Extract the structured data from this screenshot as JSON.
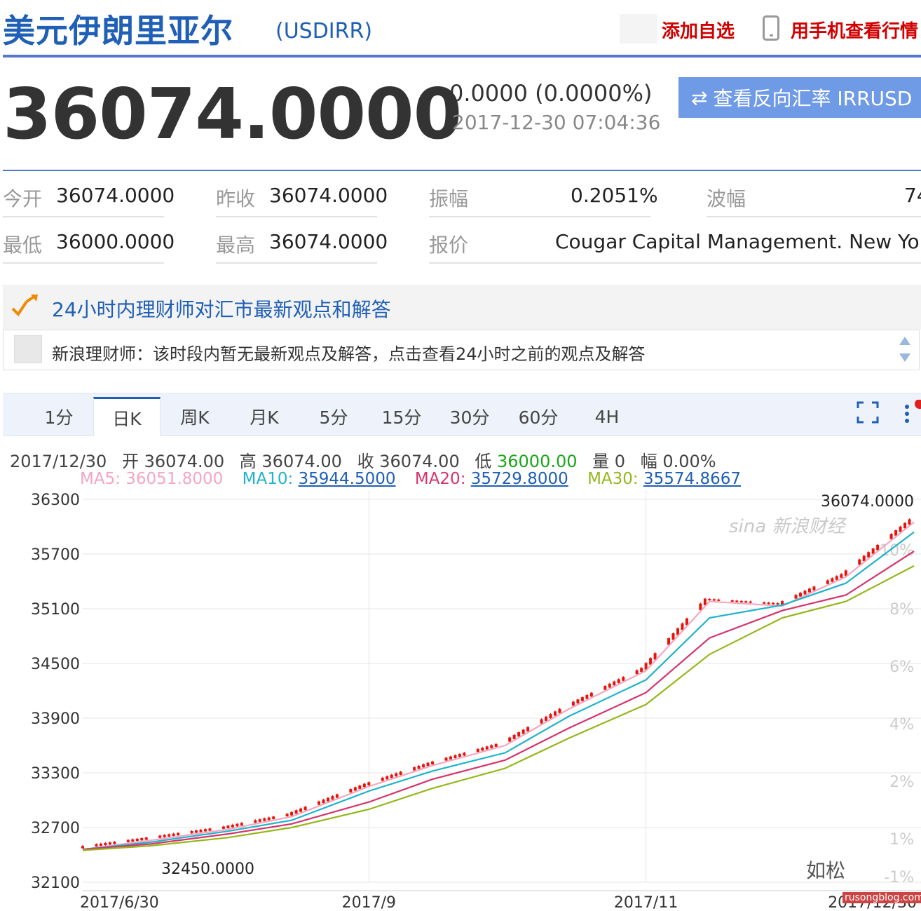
{
  "header": {
    "title": "美元伊朗里亚尔",
    "symbol": "(USDIRR)",
    "add_favorite": "添加自选",
    "mobile_view": "用手机查看行情"
  },
  "quote": {
    "price": "36074.0000",
    "change": "0.0000 (0.0000%)",
    "timestamp": "2017-12-30 07:04:36",
    "reverse_button": "查看反向汇率 IRRUSD",
    "reverse_icon": "swap-arrows-icon"
  },
  "stats": {
    "open_label": "今开",
    "open_value": "36074.0000",
    "prev_close_label": "昨收",
    "prev_close_value": "36074.0000",
    "amplitude_label": "振幅",
    "amplitude_value": "0.2051%",
    "wave_label": "波幅",
    "wave_value": "74",
    "low_label": "最低",
    "low_value": "36000.0000",
    "high_label": "最高",
    "high_value": "36074.0000",
    "quote_label": "报价",
    "quote_value": "Cougar Capital Management. New York"
  },
  "adviser": {
    "title": "24小时内理财师对汇市最新观点和解答",
    "message": "新浪理财师：该时段内暂无最新观点及解答，点击查看24小时之前的观点及解答"
  },
  "tabs": [
    {
      "label": "1分"
    },
    {
      "label": "日K"
    },
    {
      "label": "周K"
    },
    {
      "label": "月K"
    },
    {
      "label": "5分"
    },
    {
      "label": "15分"
    },
    {
      "label": "30分"
    },
    {
      "label": "60分"
    },
    {
      "label": "4H"
    }
  ],
  "active_tab": "日K",
  "kline_info": {
    "date": "2017/12/30",
    "open_label": "开",
    "open": "36074.00",
    "high_label": "高",
    "high": "36074.00",
    "close_label": "收",
    "close": "36074.00",
    "low_label": "低",
    "low": "36000.00",
    "volume_label": "量",
    "volume": "0",
    "range_label": "幅",
    "range": "0.00%",
    "ma5_label": "MA5:",
    "ma5": "36051.8000",
    "ma10_label": "MA10:",
    "ma10": "35944.5000",
    "ma20_label": "MA20:",
    "ma20": "35729.8000",
    "ma30_label": "MA30:",
    "ma30": "35574.8667"
  },
  "colors": {
    "up": "#e8140c",
    "down": "#1aa51a",
    "ma5": "#f4a6c0",
    "ma10": "#1fb3cc",
    "ma20": "#d6336c",
    "ma30": "#95b71a",
    "accent": "#1f5fb5"
  },
  "watermarks": {
    "sina": "sina 新浪财经",
    "rusong": "如松",
    "url": "rusongblog.com"
  },
  "chart_data": {
    "type": "candlestick",
    "y_ticks": [
      36300,
      35700,
      35100,
      34500,
      33900,
      33300,
      32700,
      32100
    ],
    "right_ticks": [
      "10%",
      "8%",
      "6%",
      "4%",
      "2%",
      "1%",
      "-1%"
    ],
    "x_ticks": [
      "2017/6/30",
      "2017/9",
      "2017/11",
      "2017/12/30"
    ],
    "ylim": [
      32100,
      36400
    ],
    "annotations": {
      "max": "36074.0000",
      "min": "32450.0000"
    },
    "grid": true,
    "series": [
      {
        "name": "MA5",
        "x": [
          "2017/6/30",
          "2017/7/15",
          "2017/8/1",
          "2017/8/15",
          "2017/9/1",
          "2017/9/15",
          "2017/10/1",
          "2017/10/15",
          "2017/11/1",
          "2017/11/15",
          "2017/12/1",
          "2017/12/15",
          "2017/12/30"
        ],
        "values": [
          32460,
          32560,
          32680,
          32820,
          33150,
          33380,
          33600,
          34000,
          34420,
          35180,
          35130,
          35450,
          36050
        ]
      },
      {
        "name": "MA10",
        "x": [
          "2017/6/30",
          "2017/7/15",
          "2017/8/1",
          "2017/8/15",
          "2017/9/1",
          "2017/9/15",
          "2017/10/1",
          "2017/10/15",
          "2017/11/1",
          "2017/11/15",
          "2017/12/1",
          "2017/12/15",
          "2017/12/30"
        ],
        "values": [
          32460,
          32540,
          32660,
          32780,
          33100,
          33320,
          33520,
          33920,
          34320,
          35000,
          35140,
          35380,
          35940
        ]
      },
      {
        "name": "MA20",
        "x": [
          "2017/6/30",
          "2017/7/15",
          "2017/8/1",
          "2017/8/15",
          "2017/9/1",
          "2017/9/15",
          "2017/10/1",
          "2017/10/15",
          "2017/11/1",
          "2017/11/15",
          "2017/12/1",
          "2017/12/15",
          "2017/12/30"
        ],
        "values": [
          32460,
          32520,
          32630,
          32740,
          32980,
          33230,
          33440,
          33790,
          34180,
          34780,
          35080,
          35250,
          35730
        ]
      },
      {
        "name": "MA30",
        "x": [
          "2017/6/30",
          "2017/7/15",
          "2017/8/1",
          "2017/8/15",
          "2017/9/1",
          "2017/9/15",
          "2017/10/1",
          "2017/10/15",
          "2017/11/1",
          "2017/11/15",
          "2017/12/1",
          "2017/12/15",
          "2017/12/30"
        ],
        "values": [
          32450,
          32500,
          32590,
          32700,
          32900,
          33130,
          33350,
          33680,
          34050,
          34600,
          35000,
          35180,
          35570
        ]
      }
    ]
  }
}
